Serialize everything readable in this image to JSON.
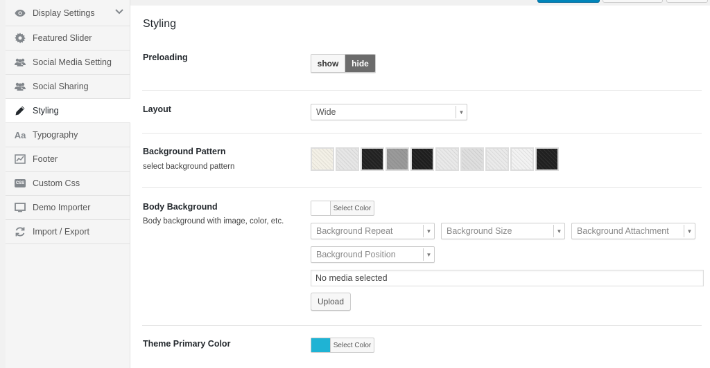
{
  "sidebar": {
    "items": [
      {
        "label": "Display Settings",
        "icon": "eye-icon"
      },
      {
        "label": "Featured Slider",
        "icon": "gear-icon"
      },
      {
        "label": "Social Media Setting",
        "icon": "users-icon"
      },
      {
        "label": "Social Sharing",
        "icon": "users-icon"
      },
      {
        "label": "Styling",
        "icon": "pencil-icon",
        "active": true
      },
      {
        "label": "Typography",
        "icon": "typography-icon",
        "glyph": "Aa"
      },
      {
        "label": "Footer",
        "icon": "chart-icon"
      },
      {
        "label": "Custom Css",
        "icon": "css-icon",
        "glyph": "CSS"
      },
      {
        "label": "Demo Importer",
        "icon": "screen-icon"
      },
      {
        "label": "Import / Export",
        "icon": "refresh-icon"
      }
    ]
  },
  "main": {
    "title": "Styling",
    "preloading": {
      "label": "Preloading",
      "options": [
        "show",
        "hide"
      ],
      "selected": "hide"
    },
    "layout": {
      "label": "Layout",
      "value": "Wide"
    },
    "background_pattern": {
      "label": "Background Pattern",
      "description": "select background pattern",
      "patterns": [
        {
          "color": "#f3f0e6"
        },
        {
          "color": "#e6e6e6"
        },
        {
          "color": "#222222"
        },
        {
          "color": "#9a9a9a"
        },
        {
          "color": "#1e1e1e"
        },
        {
          "color": "#e9e9e9"
        },
        {
          "color": "#dedede"
        },
        {
          "color": "#eaeaea"
        },
        {
          "color": "#f2f2f2"
        },
        {
          "color": "#202020"
        }
      ]
    },
    "body_background": {
      "label": "Body Background",
      "description": "Body background with image, color, etc.",
      "color_button": "Select Color",
      "color": "#ffffff",
      "repeat_placeholder": "Background Repeat",
      "size_placeholder": "Background Size",
      "attachment_placeholder": "Background Attachment",
      "position_placeholder": "Background Position",
      "media_text": "No media selected",
      "upload_label": "Upload"
    },
    "theme_primary_color": {
      "label": "Theme Primary Color",
      "color_button": "Select Color",
      "color": "#1fb3d4"
    }
  },
  "colors": {
    "accent": "#0085ba",
    "active_toggle": "#6b6b6b"
  }
}
